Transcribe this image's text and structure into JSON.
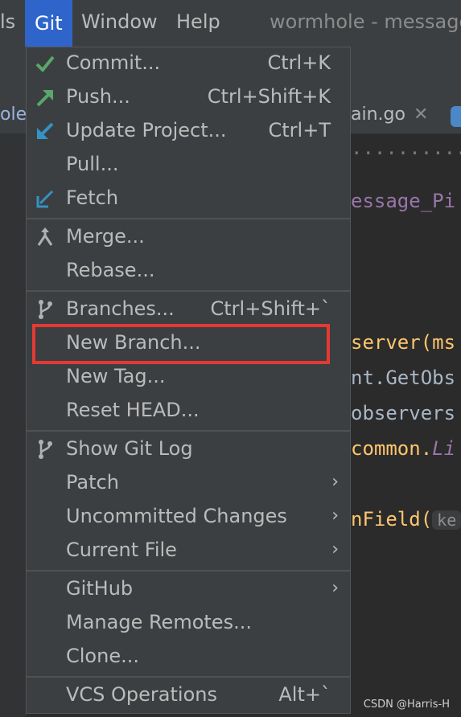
{
  "menubar": {
    "partial_left": "ls",
    "git": "Git",
    "window": "Window",
    "help": "Help",
    "title": "wormhole - message"
  },
  "tabs": {
    "left": "ole.",
    "right": "ain.go",
    "close": "✕"
  },
  "code": {
    "line1": "essage_Pi",
    "line2": "server(ms",
    "line3": "nt.GetObs",
    "line4": "observers",
    "line5_a": "common.",
    "line5_b": "Li",
    "line6": "nField(",
    "hint": "ke"
  },
  "menu": {
    "items": [
      {
        "label": "Commit...",
        "shortcut": "Ctrl+K",
        "icon": "check-icon"
      },
      {
        "label": "Push...",
        "shortcut": "Ctrl+Shift+K",
        "icon": "push-arrow-icon"
      },
      {
        "label": "Update Project...",
        "shortcut": "Ctrl+T",
        "icon": "update-arrow-icon"
      },
      {
        "label": "Pull..."
      },
      {
        "label": "Fetch",
        "icon": "fetch-arrow-icon"
      },
      {
        "label": "Merge...",
        "icon": "merge-icon"
      },
      {
        "label": "Rebase..."
      },
      {
        "label": "Branches...",
        "shortcut": "Ctrl+Shift+`",
        "icon": "branch-icon"
      },
      {
        "label": "New Branch..."
      },
      {
        "label": "New Tag..."
      },
      {
        "label": "Reset HEAD..."
      },
      {
        "label": "Show Git Log",
        "icon": "branch-icon"
      },
      {
        "label": "Patch",
        "submenu": true
      },
      {
        "label": "Uncommitted Changes",
        "submenu": true
      },
      {
        "label": "Current File",
        "submenu": true
      },
      {
        "label": "GitHub",
        "submenu": true
      },
      {
        "label": "Manage Remotes..."
      },
      {
        "label": "Clone..."
      },
      {
        "label": "VCS Operations",
        "shortcut": "Alt+`"
      }
    ],
    "submenu_arrow": "›"
  },
  "watermark": "CSDN @Harris-H",
  "colors": {
    "accent": "#2f65ca",
    "highlight_box": "#e53935",
    "check_green": "#59a869",
    "arrow_blue": "#3592c4"
  }
}
